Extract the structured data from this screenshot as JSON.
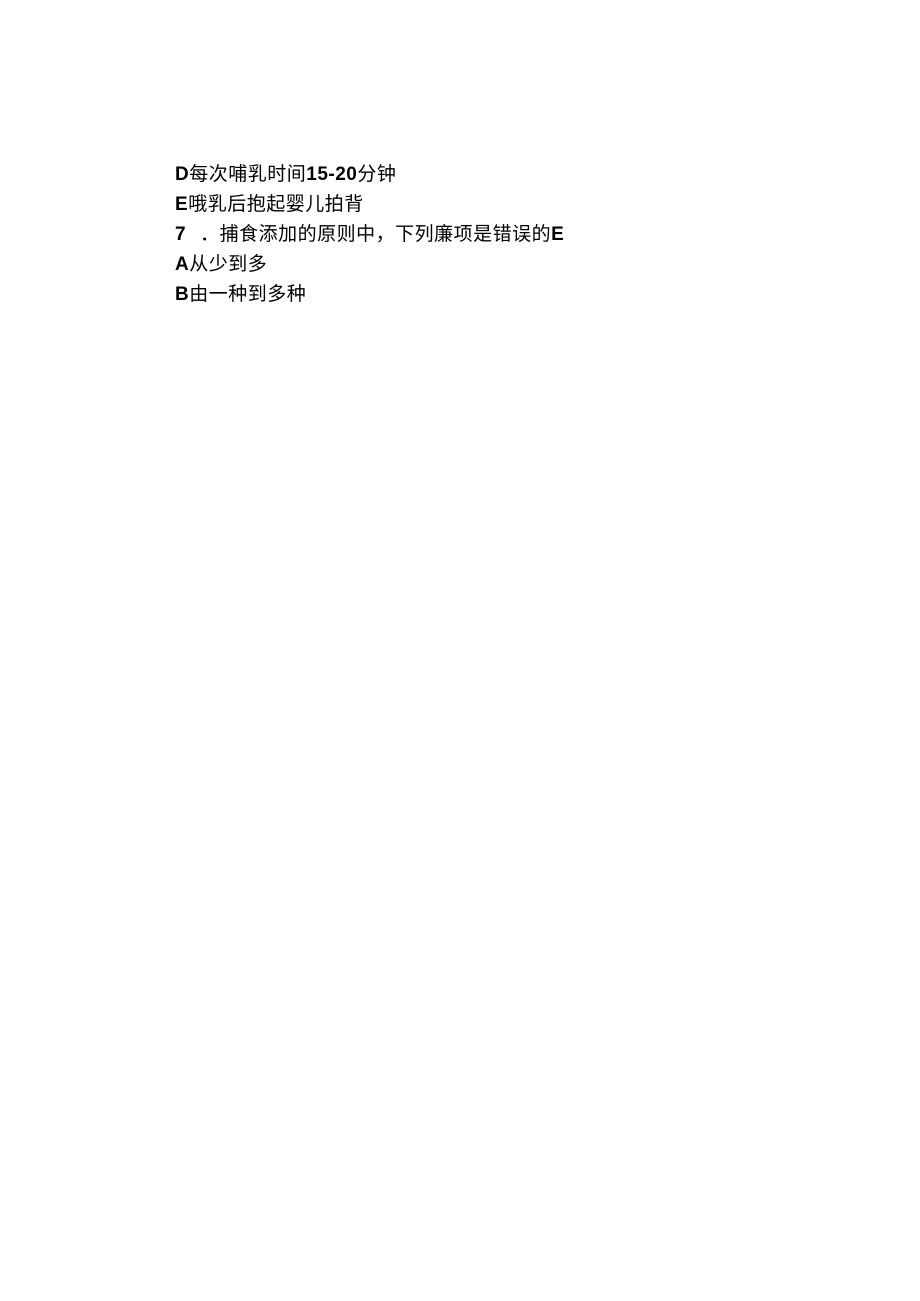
{
  "lines": {
    "optD_prefix": "D",
    "optD_text": "每次哺乳时间",
    "optD_num": "15-20",
    "optD_suffix": "分钟",
    "optE_prefix": "E",
    "optE_text": "哦乳后抱起婴儿拍背",
    "q7_num": "7",
    "q7_dot": "．",
    "q7_text": "捕食添加的原则中，下列廉项是错误的",
    "q7_answer": "E",
    "optA_prefix": "A",
    "optA_text": "从少到多",
    "optB_prefix": "B",
    "optB_text": "由一种到多种"
  }
}
